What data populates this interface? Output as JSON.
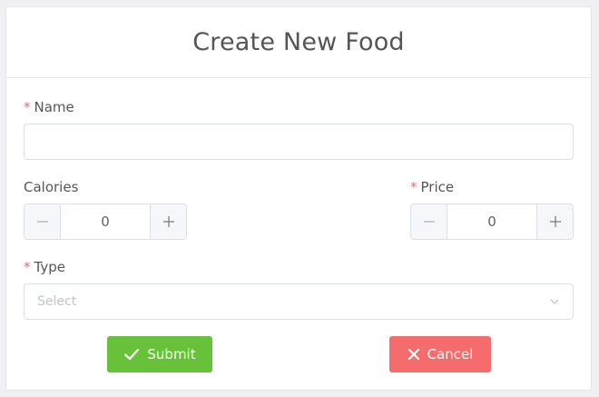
{
  "dialog": {
    "title": "Create New Food"
  },
  "form": {
    "name": {
      "label": "Name",
      "required_mark": "*",
      "value": ""
    },
    "calories": {
      "label": "Calories",
      "value": "0"
    },
    "price": {
      "label": "Price",
      "required_mark": "*",
      "value": "0"
    },
    "type": {
      "label": "Type",
      "required_mark": "*",
      "placeholder": "Select"
    }
  },
  "actions": {
    "submit_label": "Submit",
    "cancel_label": "Cancel"
  },
  "colors": {
    "required": "#f56c6c",
    "submit": "#67c23a",
    "cancel": "#f56c6c"
  }
}
